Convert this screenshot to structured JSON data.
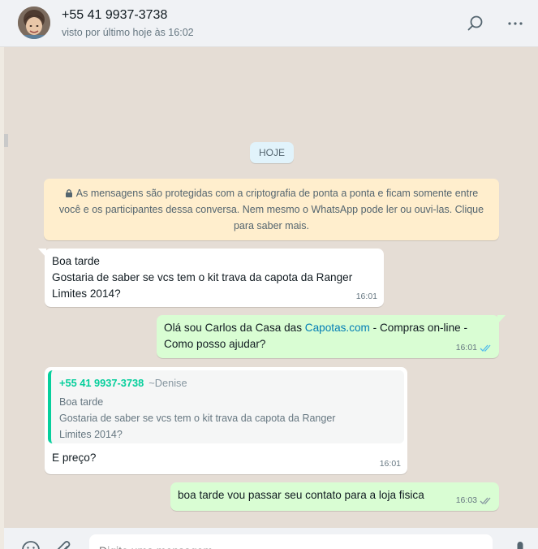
{
  "header": {
    "contact_name": "+55 41 9937-3738",
    "last_seen": "visto por último hoje às 16:02",
    "icons": [
      "avatar",
      "search-icon",
      "menu-icon"
    ]
  },
  "chat": {
    "date_chip": "HOJE",
    "encryption_notice": "As mensagens são protegidas com a criptografia de ponta a ponta e ficam somente entre você e os participantes dessa conversa. Nem mesmo o WhatsApp pode ler ou ouvi-las. Clique para saber mais.",
    "messages": [
      {
        "direction": "in",
        "line1": "Boa tarde",
        "line2": "Gostaria de saber se vcs tem o kit trava da capota da Ranger",
        "line3": "Limites 2014?",
        "time": "16:01"
      },
      {
        "direction": "out",
        "text_before": "Olá sou Carlos da Casa das ",
        "link_text": "Capotas.com",
        "text_after": " -  Compras on-line -",
        "line2": "Como posso ajudar?",
        "time": "16:01",
        "status": "read"
      },
      {
        "direction": "in",
        "quote": {
          "phone": "+55 41 9937-3738",
          "name": "~Denise",
          "line1": "Boa tarde",
          "line2": "Gostaria de saber se vcs tem o kit trava da capota da Ranger",
          "line3": "Limites 2014?"
        },
        "text": "E preço?",
        "time": "16:01"
      },
      {
        "direction": "out",
        "text": "boa tarde vou passar seu contato para a loja fisica",
        "time": "16:03",
        "status": "delivered"
      }
    ]
  },
  "footer": {
    "input_placeholder": "Digite uma mensagem",
    "icons": [
      "emoji-icon",
      "attach-icon",
      "mic-icon"
    ]
  },
  "colors": {
    "outgoing_bubble": "#d9fdd3",
    "incoming_bubble": "#ffffff",
    "notice_bg": "#ffeecd",
    "date_chip_bg": "#e1f3fb",
    "quote_accent": "#06cf9c",
    "link": "#027eb5",
    "read_ticks": "#53bdeb"
  }
}
